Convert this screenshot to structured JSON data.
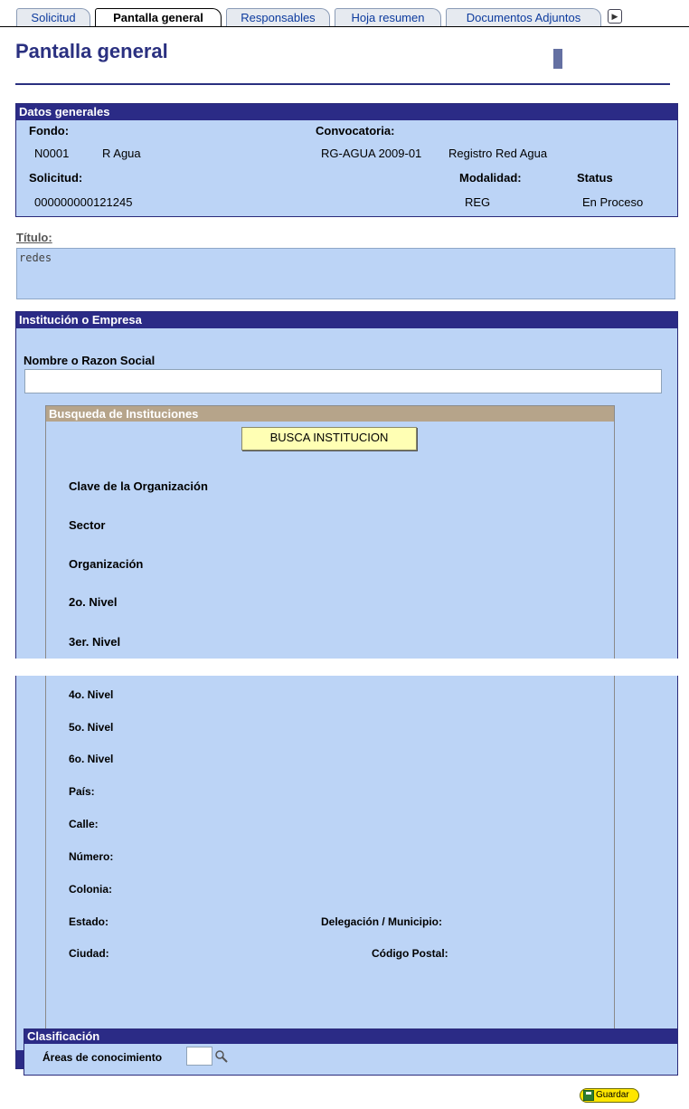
{
  "tabs": [
    {
      "label": "Solicitud"
    },
    {
      "label": "Pantalla general"
    },
    {
      "label": "Responsables"
    },
    {
      "label": "Hoja resumen"
    },
    {
      "label": "Documentos Adjuntos"
    }
  ],
  "page_title": "Pantalla general",
  "datos_generales": {
    "header": "Datos generales",
    "fondo_label": "Fondo:",
    "fondo_code": "N0001",
    "fondo_name": "R Agua",
    "convocatoria_label": "Convocatoria:",
    "convocatoria_code": "RG-AGUA 2009-01",
    "convocatoria_name": "Registro Red Agua",
    "solicitud_label": "Solicitud:",
    "solicitud_value": "000000000121245",
    "modalidad_label": "Modalidad:",
    "modalidad_value": "REG",
    "status_label": "Status",
    "status_value": "En Proceso"
  },
  "titulo": {
    "label": "Título:",
    "value": "redes"
  },
  "institucion": {
    "header": "Institución o Empresa",
    "nombre_label": "Nombre o Razon Social",
    "nombre_value": "",
    "busqueda_header": "Busqueda de Instituciones",
    "busca_button": "BUSCA INSTITUCION",
    "fields": {
      "clave": "Clave de la Organización",
      "sector": "Sector",
      "organizacion": "Organización",
      "nivel2": "2o. Nivel",
      "nivel3": "3er. Nivel",
      "nivel4": "4o. Nivel",
      "nivel5": "5o. Nivel",
      "nivel6": "6o. Nivel",
      "pais": "País:",
      "calle": "Calle:",
      "numero": "Número:",
      "colonia": "Colonia:",
      "estado": "Estado:",
      "delegacion": "Delegación / Municipio:",
      "ciudad": "Ciudad:",
      "codigo_postal": "Código Postal:"
    }
  },
  "clasificacion": {
    "header": "Clasificación",
    "areas_label": "Áreas de conocimiento",
    "areas_value": ""
  },
  "guardar_label": "Guardar",
  "colors": {
    "panel_bg": "#bcd4f6",
    "header_bg": "#2b2b86",
    "subheader_bg": "#b6a48a",
    "button_bg": "#ffffb4",
    "title_color": "#2a3080"
  }
}
